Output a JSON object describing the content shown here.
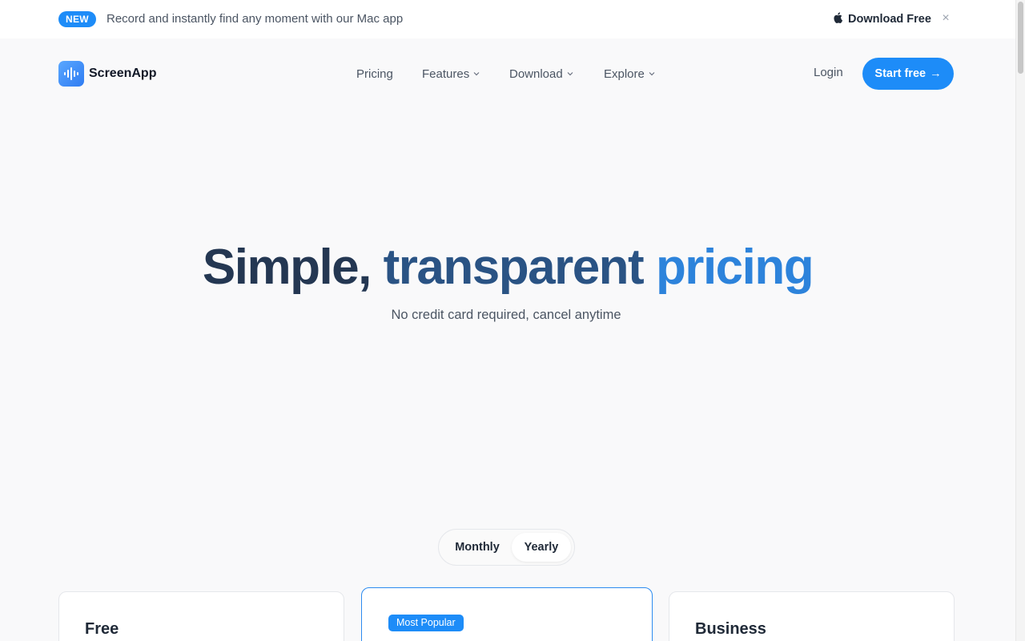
{
  "announcement": {
    "badge": "NEW",
    "text": "Record and instantly find any moment with our Mac app",
    "download_label": "Download Free",
    "close_glyph": "×",
    "download_icon": "apple-icon"
  },
  "brand": {
    "name": "ScreenApp",
    "logo_icon": "waveform-icon",
    "accent": "#1d8cf8"
  },
  "nav": {
    "items": [
      {
        "label": "Pricing",
        "has_dropdown": false
      },
      {
        "label": "Features",
        "has_dropdown": true
      },
      {
        "label": "Download",
        "has_dropdown": true
      },
      {
        "label": "Explore",
        "has_dropdown": true
      }
    ],
    "login_label": "Login",
    "cta_label": "Start free",
    "cta_arrow": "→"
  },
  "hero": {
    "title_part1": "Simple,",
    "title_part2": "transparent",
    "title_part3": "pricing",
    "subtitle": "No credit card required, cancel anytime"
  },
  "billing": {
    "options": [
      "Monthly",
      "Yearly"
    ],
    "selected": "Yearly"
  },
  "plans": [
    {
      "name": "Free",
      "badge": ""
    },
    {
      "name": "",
      "badge": "Most Popular"
    },
    {
      "name": "Business",
      "badge": ""
    }
  ]
}
